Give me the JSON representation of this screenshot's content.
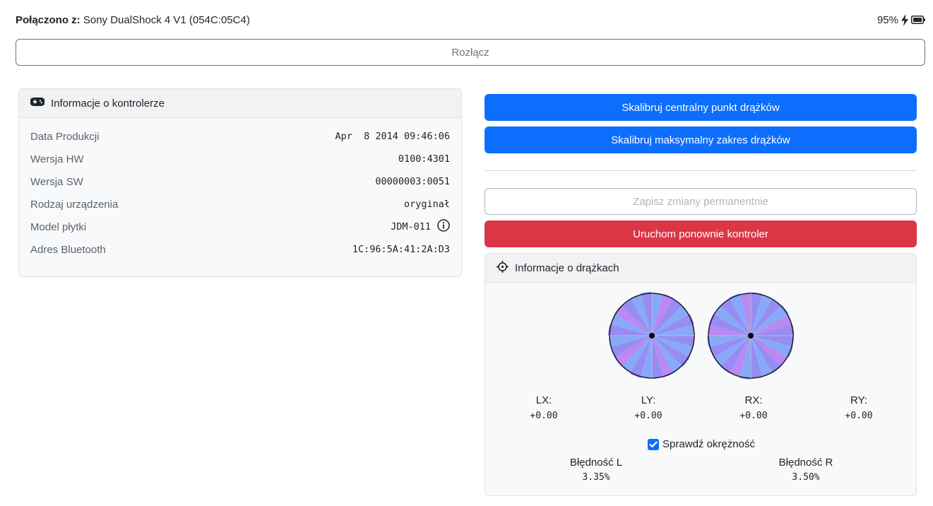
{
  "status": {
    "connected_label": "Połączono z:",
    "device_name": "Sony DualShock 4 V1 (054C:05C4)",
    "battery_percent": "95%",
    "battery_icon": "battery-full-icon",
    "charging_icon": "bolt-icon"
  },
  "disconnect_label": "Rozłącz",
  "controller_info": {
    "title": "Informacje o kontrolerze",
    "icon": "gamepad-icon",
    "rows": [
      {
        "label": "Data Produkcji",
        "value": "Apr  8 2014 09:46:06"
      },
      {
        "label": "Wersja HW",
        "value": "0100:4301"
      },
      {
        "label": "Wersja SW",
        "value": "00000003:0051"
      },
      {
        "label": "Rodzaj urządzenia",
        "value": "oryginał"
      },
      {
        "label": "Model płytki",
        "value": "JDM-011"
      },
      {
        "label": "Adres Bluetooth",
        "value": "1C:96:5A:41:2A:D3"
      }
    ],
    "board_model_info_icon": "info-circle-icon"
  },
  "actions": {
    "calibrate_center": "Skalibruj centralny punkt drążków",
    "calibrate_range": "Skalibruj maksymalny zakres drążków",
    "save_permanent": "Zapisz zmiany permanentnie",
    "reboot": "Uruchom ponownie kontroler"
  },
  "stick_info": {
    "title": "Informacje o drążkach",
    "icon": "crosshair-icon",
    "axes": [
      {
        "label": "LX:",
        "value": "+0.00"
      },
      {
        "label": "LY:",
        "value": "+0.00"
      },
      {
        "label": "RX:",
        "value": "+0.00"
      },
      {
        "label": "RY:",
        "value": "+0.00"
      }
    ],
    "check_circularity_label": "Sprawdź okrężność",
    "check_circularity_checked": true,
    "error_left_label": "Błędność L",
    "error_left_value": "3.35%",
    "error_right_label": "Błędność R",
    "error_right_value": "3.50%"
  },
  "colors": {
    "primary": "#0d6efd",
    "danger": "#dc3545",
    "stick_fill_a": "#8c7ff0",
    "stick_fill_b": "#7aa0f8",
    "stick_fill_c": "#b27cf0"
  }
}
